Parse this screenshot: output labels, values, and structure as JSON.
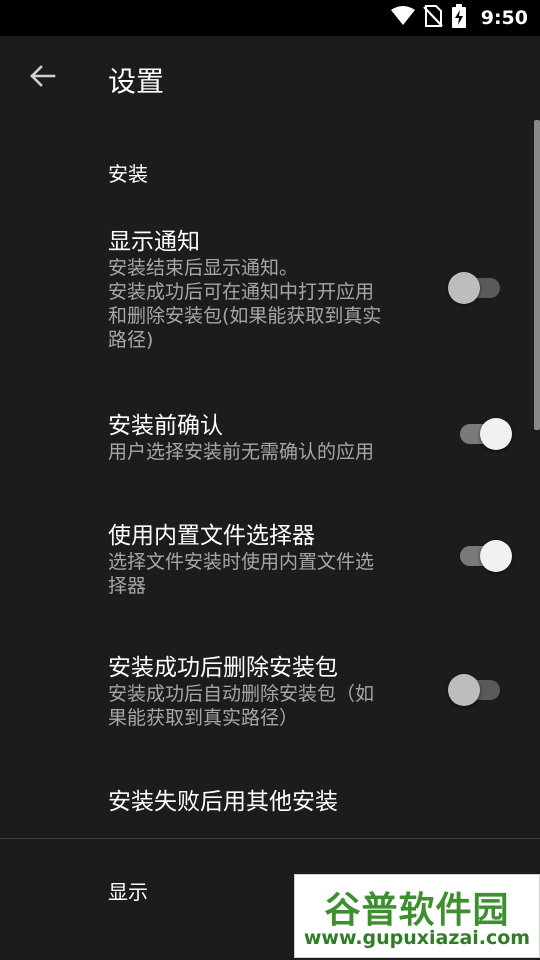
{
  "status_bar": {
    "time": "9:50",
    "icons": [
      "wifi-icon",
      "no-sim-icon",
      "battery-charging-icon"
    ]
  },
  "app_bar": {
    "back_icon": "arrow-back-icon",
    "title": "设置"
  },
  "sections": [
    {
      "category": "安装",
      "prefs": [
        {
          "title": "显示通知",
          "summary_lines": [
            "安装结束后显示通知。",
            "安装成功后可在通知中打开应用",
            "和删除安装包(如果能获取到真实",
            "路径)"
          ],
          "toggle": false
        },
        {
          "title": "安装前确认",
          "summary_lines": [
            "用户选择安装前无需确认的应用"
          ],
          "toggle": true
        },
        {
          "title": "使用内置文件选择器",
          "summary_lines": [
            "选择文件安装时使用内置文件选",
            "择器"
          ],
          "toggle": true
        },
        {
          "title": "安装成功后删除安装包",
          "summary_lines": [
            "安装成功后自动删除安装包（如",
            "果能获取到真实路径）"
          ],
          "toggle": false
        },
        {
          "title": "安装失败后用其他安装"
        }
      ]
    },
    {
      "category": "显示"
    }
  ],
  "watermark": {
    "name": "谷普软件园",
    "url": "www.gupuxiazai.com"
  },
  "colors": {
    "background": "#1c1c1c",
    "status_bar": "#000000",
    "summary_text": "#a6a6a6",
    "toggle_on_thumb": "#f1f1f1",
    "toggle_off_thumb": "#bdbdbd"
  }
}
